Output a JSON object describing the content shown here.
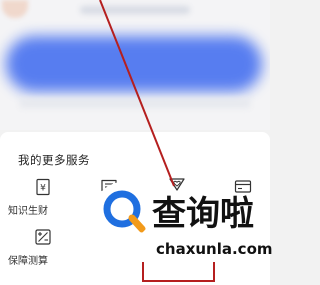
{
  "services": {
    "title": "我的更多服务",
    "items": [
      {
        "label": "知识生财",
        "icon": "money-book-icon"
      },
      {
        "label": "",
        "icon": "message-icon"
      },
      {
        "label": "",
        "icon": "heart-ribbon-icon"
      },
      {
        "label": "",
        "icon": "card-icon"
      },
      {
        "label": "保障测算",
        "icon": "calculator-icon"
      }
    ]
  },
  "watermark": {
    "title": "查询啦",
    "domain": "chaxunla.com"
  },
  "colors": {
    "banner": "#4f77f0",
    "annotation": "#b51f1f",
    "logo_blue": "#1f6fe0",
    "logo_orange": "#f29a1a"
  }
}
